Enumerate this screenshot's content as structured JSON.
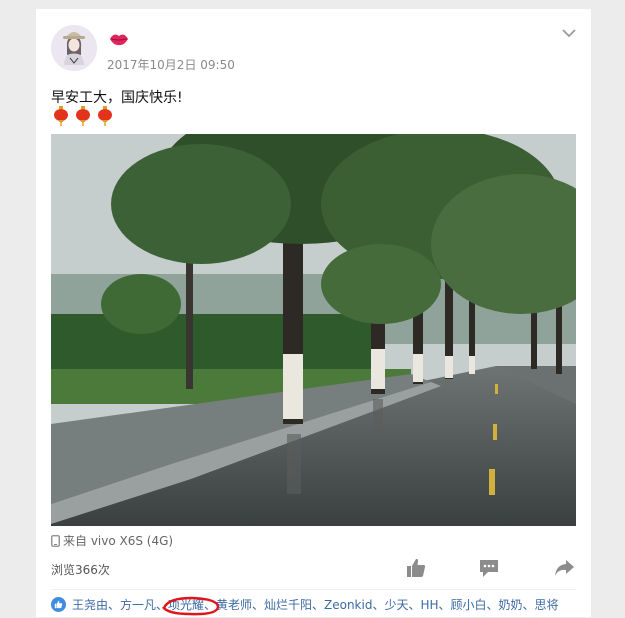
{
  "post": {
    "timestamp": "2017年10月2日 09:50",
    "text": "早安工大，国庆快乐!",
    "device": "来自 vivo X6S (4G)",
    "views": "浏览366次"
  },
  "likes": {
    "names": "王尧由、方一凡、项光耀、黄老师、灿烂千阳、Zeonkid、少天、HH、顾小白、奶奶、思将"
  },
  "icons": {
    "header": [
      "avatar",
      "kiss-lips-icon",
      "chevron-down-icon"
    ],
    "actions": [
      "thumbs-up-icon",
      "comment-icon",
      "share-icon"
    ]
  },
  "colors": {
    "link": "#3d6aa5",
    "like_badge": "#3e8de0",
    "highlight": "#e0151c"
  }
}
